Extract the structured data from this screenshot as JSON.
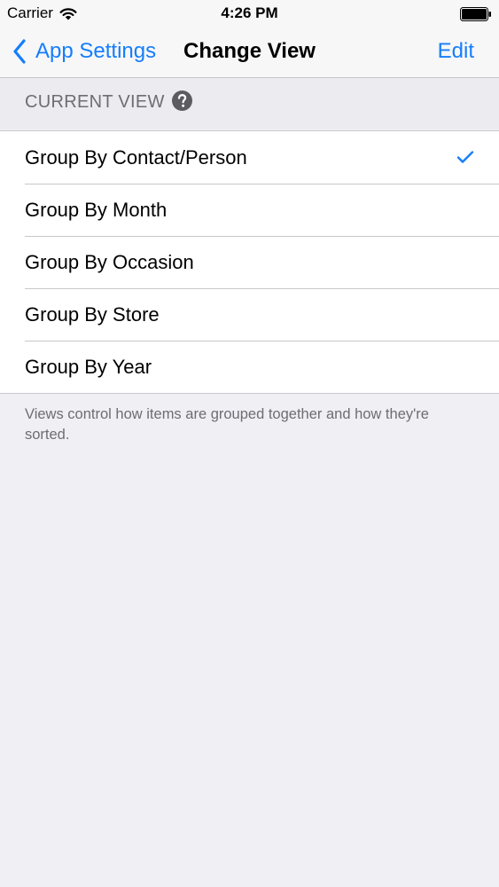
{
  "status_bar": {
    "carrier": "Carrier",
    "time": "4:26 PM",
    "icons": [
      "wifi-icon",
      "battery-icon"
    ]
  },
  "nav": {
    "back_label": "App Settings",
    "title": "Change View",
    "edit_label": "Edit",
    "accent_color": "#157efb"
  },
  "section": {
    "header": "CURRENT VIEW",
    "help_icon": "question-circle-icon",
    "items": [
      {
        "label": "Group By Contact/Person",
        "selected": true
      },
      {
        "label": "Group By Month",
        "selected": false
      },
      {
        "label": "Group By Occasion",
        "selected": false
      },
      {
        "label": "Group By Store",
        "selected": false
      },
      {
        "label": "Group By Year",
        "selected": false
      }
    ],
    "footer": "Views control how items are grouped together and how they're sorted."
  }
}
